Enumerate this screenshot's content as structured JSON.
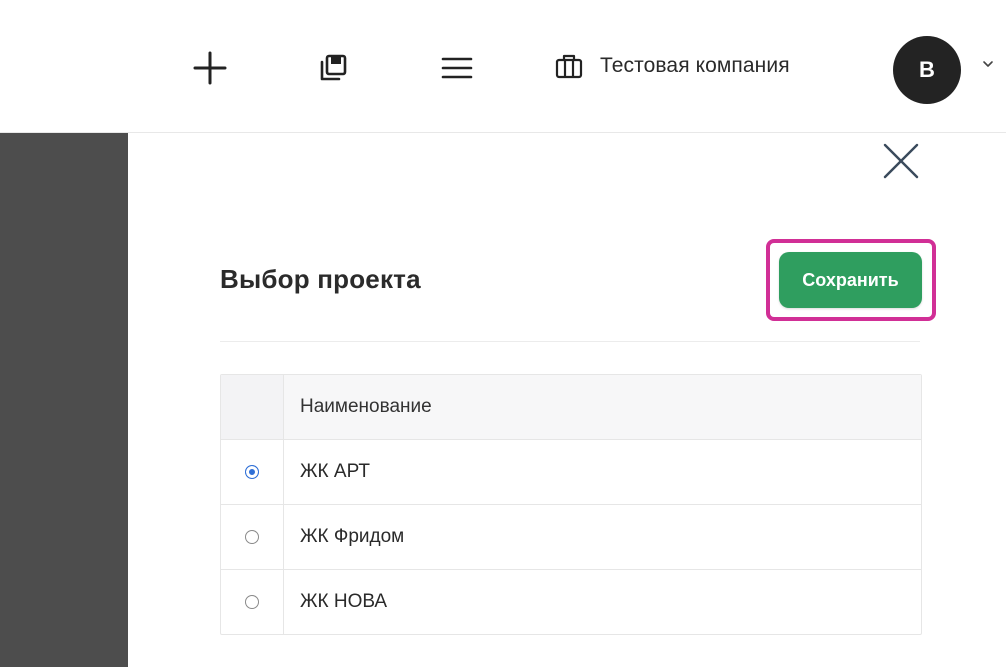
{
  "topbar": {
    "company_name": "Тестовая компания",
    "avatar_letter": "B"
  },
  "modal": {
    "title": "Выбор проекта",
    "save_label": "Сохранить",
    "highlight_color": "#d12f96",
    "save_color": "#2f9e5f"
  },
  "table": {
    "header": "Наименование",
    "rows": [
      {
        "name": "ЖК АРТ",
        "selected": true
      },
      {
        "name": "ЖК Фридом",
        "selected": false
      },
      {
        "name": "ЖК НОВА",
        "selected": false
      }
    ]
  },
  "icons": {
    "add": "plus-icon",
    "copy": "copy-icon",
    "menu": "hamburger-menu-icon",
    "company": "briefcase-icon",
    "close": "close-icon",
    "caret": "chevron-down-icon"
  }
}
